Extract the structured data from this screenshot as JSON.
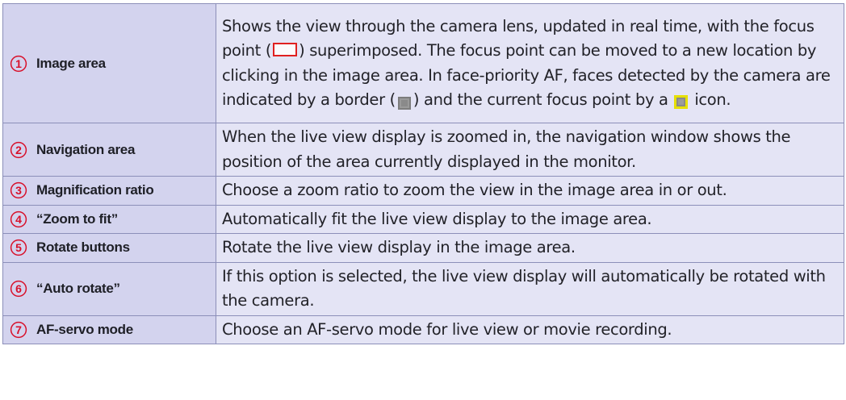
{
  "rows": [
    {
      "num": "1",
      "label": "Image area",
      "desc": [
        {
          "t": "Shows the view through the camera lens, updated in real time, with the focus point ("
        },
        {
          "icon": "focus-point-icon"
        },
        {
          "t": ") superimposed. The focus point can be moved to a new location by clicking in the image area. In face-priority AF, faces detected by the camera are indicated by a border ("
        },
        {
          "icon": "face-border-icon"
        },
        {
          "t": ") and the current focus point by a "
        },
        {
          "icon": "face-focus-point-icon"
        },
        {
          "t": " icon."
        }
      ]
    },
    {
      "num": "2",
      "label": "Navigation area",
      "desc": [
        {
          "t": "When the live view display is zoomed in, the navigation window shows the position of the area currently displayed in the monitor."
        }
      ]
    },
    {
      "num": "3",
      "label": "Magnification ratio",
      "desc": [
        {
          "t": "Choose a zoom ratio to zoom the view in the image area in or out."
        }
      ]
    },
    {
      "num": "4",
      "label": "“Zoom to fit”",
      "desc": [
        {
          "t": "Automatically fit the live view display to the image area."
        }
      ]
    },
    {
      "num": "5",
      "label": "Rotate buttons",
      "desc": [
        {
          "t": "Rotate the live view display in the image area."
        }
      ]
    },
    {
      "num": "6",
      "label": "“Auto rotate”",
      "desc": [
        {
          "t": "If this option is selected, the live view display will automatically be rotated with the camera."
        }
      ]
    },
    {
      "num": "7",
      "label": "AF-servo mode",
      "desc": [
        {
          "t": "Choose an AF-servo mode for live view or movie recording."
        }
      ]
    }
  ],
  "colors": {
    "number": "#d8102a",
    "label_bg": "#d3d3ee",
    "desc_bg": "#e4e4f5",
    "border": "#8c8fb9",
    "focus_point": "#e02020",
    "face_border": "#7d7d7d",
    "face_focus": "#e6e000"
  }
}
